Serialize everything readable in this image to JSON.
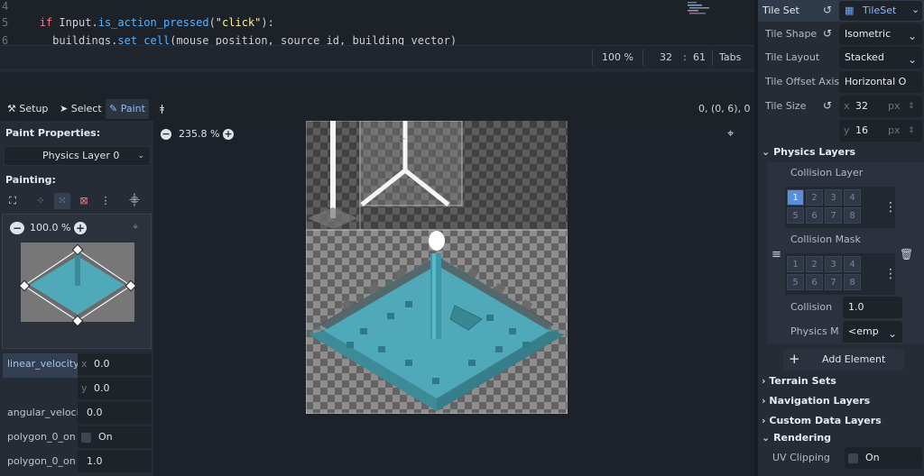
{
  "code": {
    "lines": [
      {
        "num": "4",
        "text": ""
      },
      {
        "num": "5",
        "kw": "if",
        "obj": "Input",
        "dot": ".",
        "fn": "is_action_pressed",
        "open": "(",
        "str": "\"click\"",
        "close": "):"
      },
      {
        "num": "6",
        "obj": "buildings",
        "fn": "set_cell",
        "args": "(mouse_position, source_id, building_vector)"
      }
    ]
  },
  "statusbar": {
    "zoom": "100 %",
    "line": "32",
    "sep": ":",
    "col": "61",
    "indent": "Tabs"
  },
  "toolbar": {
    "setup": "Setup",
    "select": "Select",
    "paint": "Paint",
    "coords": "0, (0, 6), 0"
  },
  "left_panel": {
    "paint_properties": "Paint Properties:",
    "physics_layer": "Physics Layer 0",
    "painting": "Painting:",
    "preview_zoom": "100.0 %",
    "props": [
      {
        "label": "linear_velocity",
        "x": "0.0",
        "y": "0.0"
      },
      {
        "label": "angular_veloci",
        "value": "0.0"
      },
      {
        "label": "polygon_0_on",
        "value": "On"
      },
      {
        "label": "polygon_0_on",
        "value": "1.0"
      }
    ],
    "axis_x": "x",
    "axis_y": "y"
  },
  "viewport": {
    "zoom": "235.8 %"
  },
  "inspector": {
    "tileset_label": "Tile Set",
    "tileset_value": "TileSet",
    "tile_shape_label": "Tile Shape",
    "tile_shape_value": "Isometric",
    "tile_layout_label": "Tile Layout",
    "tile_layout_value": "Stacked",
    "tile_offset_label": "Tile Offset Axis",
    "tile_offset_value": "Horizontal O",
    "tile_size_label": "Tile Size",
    "tile_size_x": "32",
    "tile_size_y": "16",
    "px": "px",
    "physics_layers": "Physics Layers",
    "collision_layer": "Collision Layer",
    "collision_mask": "Collision Mask",
    "layer_numbers": [
      "1",
      "2",
      "3",
      "4",
      "5",
      "6",
      "7",
      "8"
    ],
    "collision_label": "Collision",
    "collision_value": "1.0",
    "physics_material_label": "Physics M",
    "physics_material_value": "<emp",
    "add_element": "Add Element",
    "terrain_sets": "Terrain Sets",
    "navigation_layers": "Navigation Layers",
    "custom_data_layers": "Custom Data Layers",
    "rendering": "Rendering",
    "uv_clipping_label": "UV Clipping",
    "uv_clipping_value": "On"
  },
  "colors": {
    "accent": "#5a8ddb",
    "teal": "#4fa9b8",
    "tileset_icon": "#6fa8ff"
  }
}
